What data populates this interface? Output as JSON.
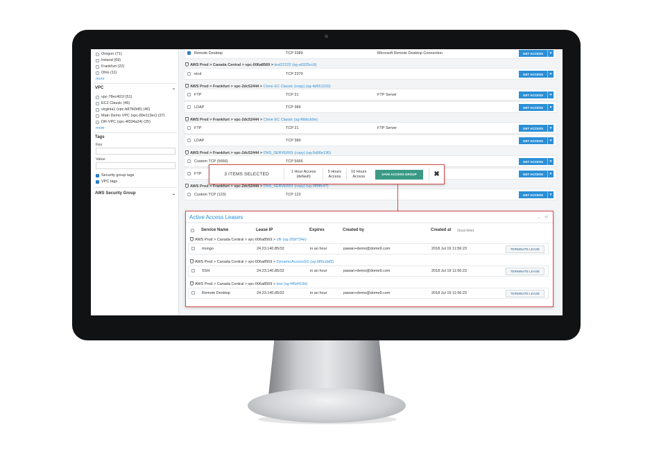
{
  "colors": {
    "accent": "#2b8fd6",
    "save": "#3b9a85",
    "highlight": "#d44a4a"
  },
  "sidebar": {
    "regions": [
      {
        "label": "Oregon (71)",
        "checked": false
      },
      {
        "label": "Ireland (69)",
        "checked": false
      },
      {
        "label": "Frankfurt (22)",
        "checked": false
      },
      {
        "label": "Ohio (11)",
        "checked": false
      }
    ],
    "more_label": "more",
    "vpc_heading": "VPC",
    "vpcs": [
      {
        "label": "vpc-78ec401f (51)"
      },
      {
        "label": "EC2 Classic (46)"
      },
      {
        "label": "virginia1 (vpc-b87fd3d5) (40)"
      },
      {
        "label": "Main Demo VPC (vpc-89e113ec) (37)"
      },
      {
        "label": "DR-VPC (vpc-4f334a24) (25)"
      }
    ],
    "vpc_more_label": "more",
    "tags_heading": "Tags",
    "key_label": "Key",
    "value_label": "Value",
    "tag_checks": [
      {
        "label": "Security group tags",
        "checked": true
      },
      {
        "label": "VPC tags",
        "checked": true
      }
    ],
    "aws_sg_heading": "AWS Security Group",
    "chevron": "⌄"
  },
  "main": {
    "get_access_label": "GET ACCESS",
    "caret": "▾",
    "rows": [
      {
        "name": "Remote Desktop",
        "port": "TCP 3389",
        "desc": "Microsoft Remote Desktop Connection",
        "checked": true
      },
      {
        "group_prefix": "AWS Prod > Canada Central > vpc-006a8569 >",
        "group_link": "test22222 (sg-a0325cc9)"
      },
      {
        "name": "etcd",
        "port": "TCP 2379",
        "desc": ""
      },
      {
        "group_prefix": "AWS Prod > Frankfurt > vpc-2dc52444 >",
        "group_link": "Clone EC Classic (copy) (sg-4d561220)"
      },
      {
        "name": "FTP",
        "port": "TCP 21",
        "desc": "FTP Server"
      },
      {
        "name": "LDAP",
        "port": "TCP 389",
        "desc": ""
      },
      {
        "group_prefix": "AWS Prod > Frankfurt > vpc-2dc52444 >",
        "group_link": "Clone EC Classic (sg-f6bbcb9e)"
      },
      {
        "name": "FTP",
        "port": "TCP 21",
        "desc": "FTP Server"
      },
      {
        "name": "LDAP",
        "port": "TCP 389",
        "desc": ""
      },
      {
        "group_prefix": "AWS Prod > Frankfurt > vpc-2dc52444 >",
        "group_link": "DNS_SERVER01 (copy) (sg-5d06e130)"
      },
      {
        "name": "Custom TCP (5666)",
        "port": "TCP 5666",
        "desc": ""
      },
      {
        "name": "FTP",
        "port": "",
        "desc": ""
      },
      {
        "group_prefix": "AWS Prod > Frankfurt > vpc-2dc52444 >",
        "group_link": "DNS_SERVER01 (copy) (sg-2ff9ffc47)"
      },
      {
        "name": "Custom TCP (123)",
        "port": "TCP 123",
        "desc": ""
      }
    ]
  },
  "selection_bar": {
    "count_label": "3 ITEMS SELECTED",
    "opt1_line1": "1 Hour Access",
    "opt1_line2": "(default)",
    "opt2_line1": "5 Hours",
    "opt2_line2": "Access",
    "opt3_line1": "10 Hours",
    "opt3_line2": "Access",
    "save_label": "SAVE ACCESS GROUP",
    "close_glyph": "✖"
  },
  "leases": {
    "title": "Active Access Leases",
    "tools": "⌄ ⟲",
    "columns": {
      "service": "Service Name",
      "ip": "Lease IP",
      "expires": "Expires",
      "created_by": "Created by",
      "created_at": "Created at",
      "created_at_note": "(local time)"
    },
    "terminate_label": "TERMINATE LEASE",
    "groups": [
      {
        "prefix": "AWS Prod > Canada Central > vpc-006a8569 >",
        "link": "cflr (sg-265f734e)",
        "service": "mongo",
        "ip": "24.23.140.85/32",
        "expires": "in an hour",
        "by": "pawan+demo@dome9.com",
        "at": "2018 Jul 19 11:56:23"
      },
      {
        "prefix": "AWS Prod > Canada Central > vpc-006a8569 >",
        "link": "DynamicAccessSG (sg-985cdaf3)",
        "service": "SSH",
        "ip": "24.23.140.85/32",
        "expires": "in an hour",
        "by": "pawan+demo@dome9.com",
        "at": "2018 Jul 19 11:56:23"
      },
      {
        "prefix": "AWS Prod > Canada Central > vpc-006a8569 >",
        "link": "test (sg-f45d419d)",
        "service": "Remote Desktop",
        "ip": "24.23.140.85/32",
        "expires": "in an hour",
        "by": "pawan+demo@dome9.com",
        "at": "2018 Jul 19 11:56:23"
      }
    ]
  }
}
